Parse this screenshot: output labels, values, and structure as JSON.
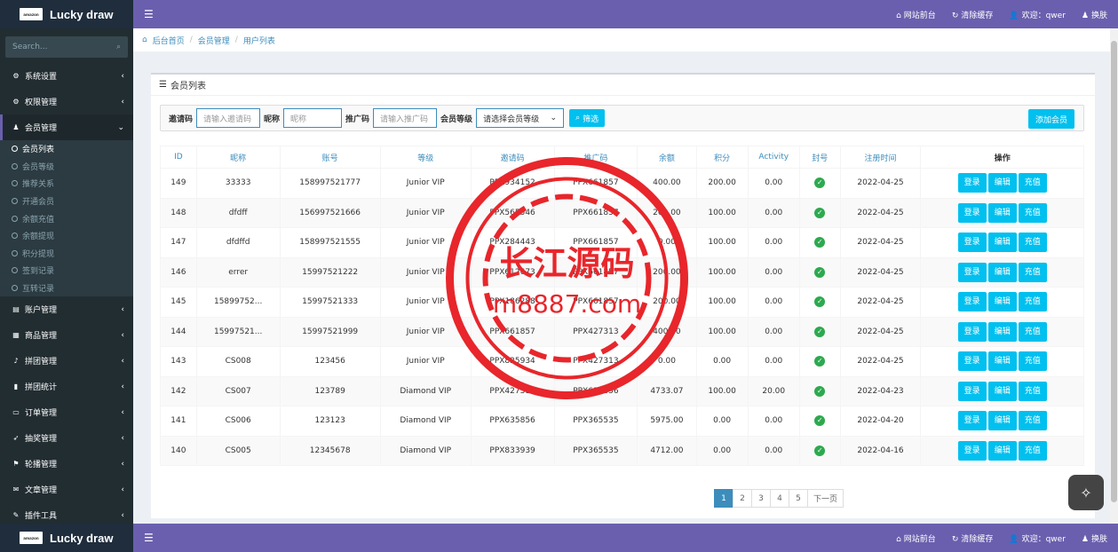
{
  "brand": {
    "name": "Lucky draw",
    "logo_text": "amazon"
  },
  "topnav": {
    "menu_icon": "bars-icon",
    "site_front": "网站前台",
    "clear_cache": "清除缓存",
    "welcome": "欢迎：qwer",
    "skin": "换肤"
  },
  "sidebar": {
    "search_placeholder": "Search...",
    "items": [
      {
        "label": "系统设置",
        "icon": "gear-icon"
      },
      {
        "label": "权限管理",
        "icon": "cogs-icon"
      },
      {
        "label": "会员管理",
        "icon": "user-icon"
      },
      {
        "label": "账户管理",
        "icon": "folder-icon"
      },
      {
        "label": "商品管理",
        "icon": "cube-icon"
      },
      {
        "label": "拼团管理",
        "icon": "bell-icon"
      },
      {
        "label": "拼团统计",
        "icon": "bar-chart-icon"
      },
      {
        "label": "订单管理",
        "icon": "list-icon"
      },
      {
        "label": "抽奖管理",
        "icon": "rocket-icon"
      },
      {
        "label": "轮播管理",
        "icon": "flag-icon"
      },
      {
        "label": "文章管理",
        "icon": "comments-icon"
      },
      {
        "label": "插件工具",
        "icon": "plug-icon"
      }
    ],
    "submenu": [
      "会员列表",
      "会员等级",
      "推荐关系",
      "开通会员",
      "余额充值",
      "余额提现",
      "积分提现",
      "签到记录",
      "互转记录"
    ]
  },
  "breadcrumb": [
    "后台首页",
    "会员管理",
    "用户列表"
  ],
  "panel": {
    "title": "会员列表"
  },
  "filter": {
    "invite_label": "邀请码",
    "invite_placeholder": "请输入邀请码",
    "nick_label": "昵称",
    "nick_placeholder": "昵称",
    "promo_label": "推广码",
    "promo_placeholder": "请输入推广码",
    "level_label": "会员等级",
    "level_value": "请选择会员等级",
    "search_btn": "筛选",
    "add_btn": "添加会员"
  },
  "table": {
    "headers": [
      "ID",
      "昵称",
      "账号",
      "等级",
      "邀请码",
      "推广码",
      "余额",
      "积分",
      "Activity",
      "封号",
      "注册时间",
      "操作"
    ],
    "actions": [
      "登录",
      "编辑",
      "充值"
    ],
    "rows": [
      [
        "149",
        "33333",
        "158997521777",
        "Junior VIP",
        "PPX934152",
        "PPX661857",
        "400.00",
        "200.00",
        "0.00",
        "2022-04-25"
      ],
      [
        "148",
        "dfdff",
        "156997521666",
        "Junior VIP",
        "PPX565546",
        "PPX661857",
        "200.00",
        "100.00",
        "0.00",
        "2022-04-25"
      ],
      [
        "147",
        "dfdffd",
        "158997521555",
        "Junior VIP",
        "PPX284443",
        "PPX661857",
        "0.00",
        "100.00",
        "0.00",
        "2022-04-25"
      ],
      [
        "146",
        "errer",
        "15997521222",
        "Junior VIP",
        "PPX612673",
        "PPX661857",
        "200.00",
        "100.00",
        "0.00",
        "2022-04-25"
      ],
      [
        "145",
        "15899752...",
        "15997521333",
        "Junior VIP",
        "PPX186288",
        "PPX661857",
        "200.00",
        "100.00",
        "0.00",
        "2022-04-25"
      ],
      [
        "144",
        "15997521...",
        "15997521999",
        "Junior VIP",
        "PPX661857",
        "PPX427313",
        "400.00",
        "100.00",
        "0.00",
        "2022-04-25"
      ],
      [
        "143",
        "CS008",
        "123456",
        "Junior VIP",
        "PPX825934",
        "PPX427313",
        "0.00",
        "0.00",
        "0.00",
        "2022-04-25"
      ],
      [
        "142",
        "CS007",
        "123789",
        "Diamond VIP",
        "PPX427313",
        "PPX635856",
        "4733.07",
        "100.00",
        "20.00",
        "2022-04-23"
      ],
      [
        "141",
        "CS006",
        "123123",
        "Diamond VIP",
        "PPX635856",
        "PPX365535",
        "5975.00",
        "0.00",
        "0.00",
        "2022-04-20"
      ],
      [
        "140",
        "CS005",
        "12345678",
        "Diamond VIP",
        "PPX833939",
        "PPX365535",
        "4712.00",
        "0.00",
        "0.00",
        "2022-04-16"
      ]
    ]
  },
  "pagination": [
    "1",
    "2",
    "3",
    "4",
    "5",
    "下一页"
  ],
  "watermark": {
    "line1": "长江源码",
    "line2": "m8887.com",
    "color": "#e8262b"
  },
  "colors": {
    "navbar": "#6a5fae",
    "sidebar": "#222d32",
    "accent": "#00c0ef",
    "link": "#3c8dbc"
  }
}
